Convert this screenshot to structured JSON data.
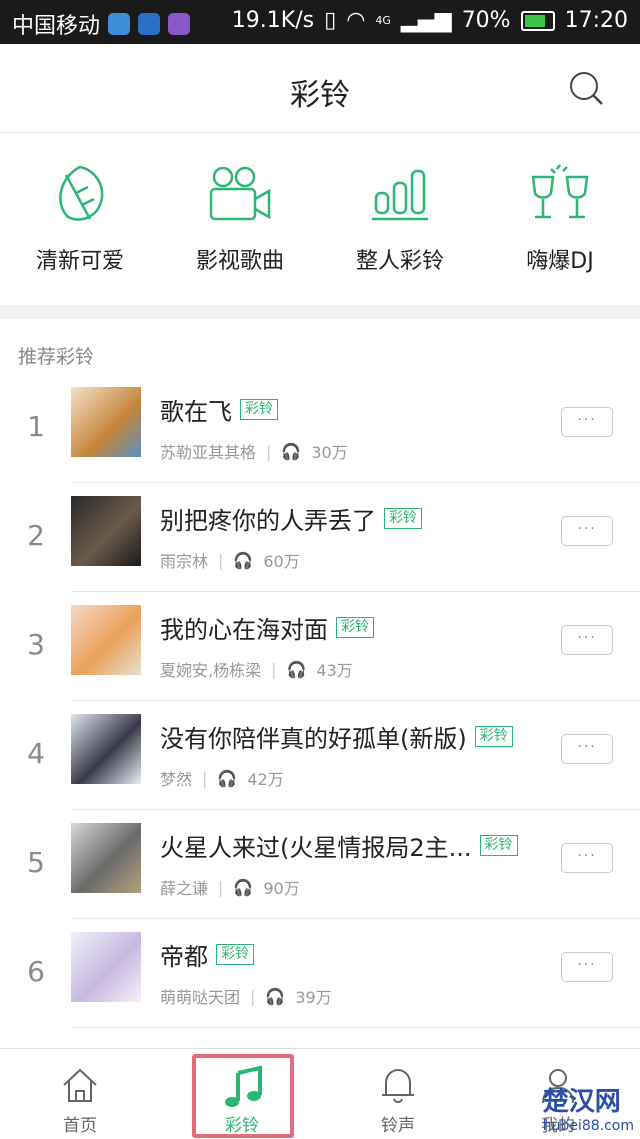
{
  "status_bar": {
    "carrier": "中国移动",
    "speed": "19.1K/s",
    "network": "4G",
    "battery": "70%",
    "time": "17:20"
  },
  "header": {
    "title": "彩铃"
  },
  "categories": [
    {
      "label": "清新可爱",
      "icon": "leaf-icon"
    },
    {
      "label": "影视歌曲",
      "icon": "video-camera-icon"
    },
    {
      "label": "整人彩铃",
      "icon": "bar-chart-icon"
    },
    {
      "label": "嗨爆DJ",
      "icon": "cheers-glasses-icon"
    }
  ],
  "section_title": "推荐彩铃",
  "tag_label": "彩铃",
  "more_label": "···",
  "songs": [
    {
      "rank": "1",
      "title": "歌在飞",
      "artist": "苏勒亚其其格",
      "plays": "30万"
    },
    {
      "rank": "2",
      "title": "别把疼你的人弄丢了",
      "artist": "雨宗林",
      "plays": "60万"
    },
    {
      "rank": "3",
      "title": "我的心在海对面",
      "artist": "夏婉安,杨栋梁",
      "plays": "43万"
    },
    {
      "rank": "4",
      "title": "没有你陪伴真的好孤单(新版)",
      "artist": "梦然",
      "plays": "42万"
    },
    {
      "rank": "5",
      "title": "火星人来过(火星情报局2主...",
      "artist": "薛之谦",
      "plays": "90万"
    },
    {
      "rank": "6",
      "title": "帝都",
      "artist": "萌萌哒天团",
      "plays": "39万"
    }
  ],
  "tabs": [
    {
      "label": "首页",
      "icon": "home-icon"
    },
    {
      "label": "彩铃",
      "icon": "music-note-icon",
      "active": true
    },
    {
      "label": "铃声",
      "icon": "bell-icon"
    },
    {
      "label": "我的",
      "icon": "person-icon"
    }
  ],
  "watermark": {
    "brand": "楚汉网",
    "domain": "hubei88.com"
  },
  "colors": {
    "accent": "#2bb673",
    "highlight": "#e26c78"
  }
}
